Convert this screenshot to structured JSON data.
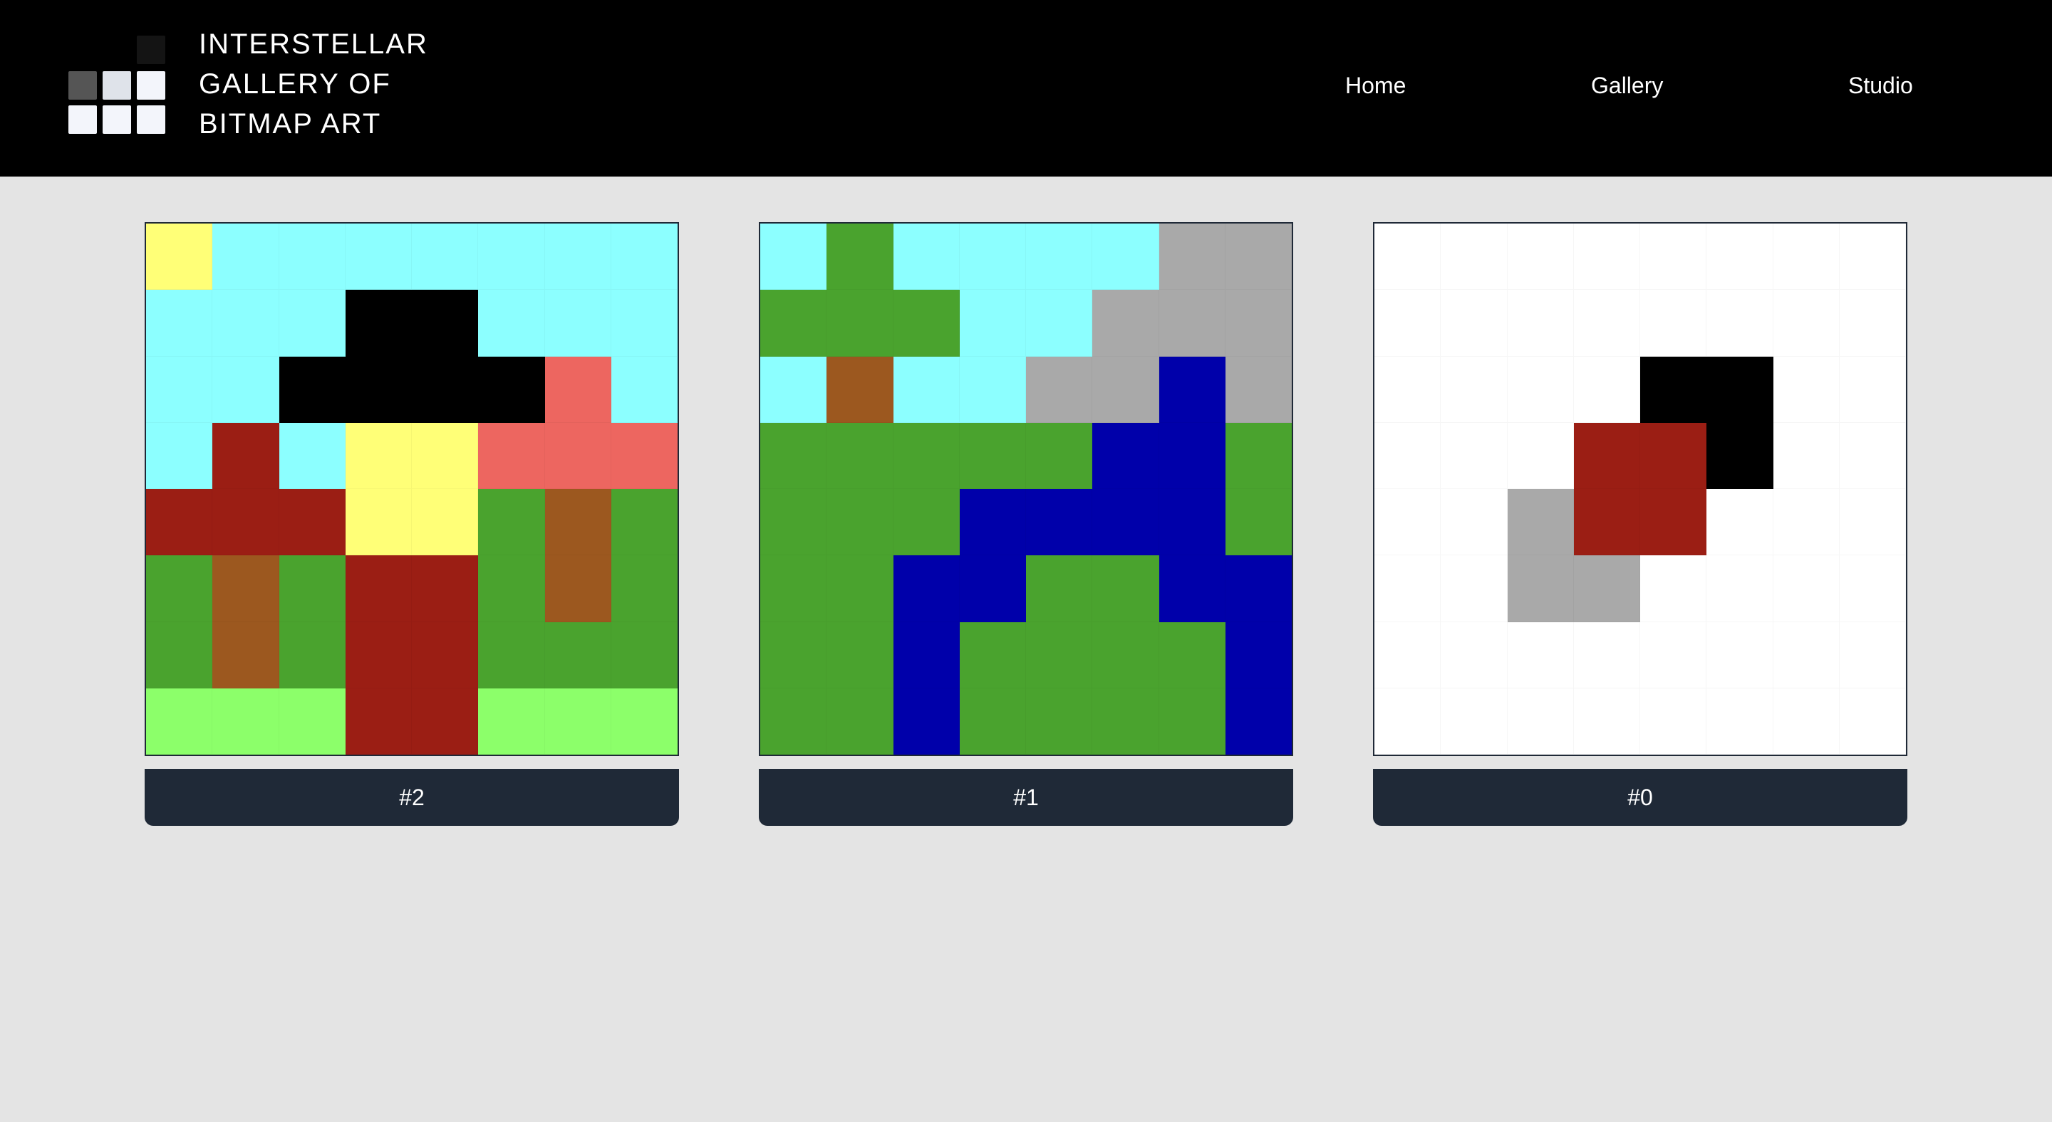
{
  "header": {
    "title": "INTERSTELLAR\nGALLERY OF\nBITMAP ART",
    "logo_icon": "pixel-grid-logo"
  },
  "nav": {
    "items": [
      {
        "label": "Home"
      },
      {
        "label": "Gallery"
      },
      {
        "label": "Studio"
      }
    ]
  },
  "palette": {
    "Y": "#ffff77",
    "S": "#8cffff",
    "K": "#000000",
    "P": "#ed6660",
    "R": "#9b1e14",
    "G": "#4aa32e",
    "B": "#9c581f",
    "L": "#8cff6a",
    "A": "#a9a9a9",
    "N": "#0000aa",
    "W": "#ffffff"
  },
  "artworks": [
    {
      "caption": "#2",
      "pixels": [
        "YSSSSSSS",
        "SSSKKSSS",
        "SSKKKKPS",
        "SRSYYPPP",
        "RRRYYGBG",
        "GBGRRGBG",
        "GBGRRGGG",
        "LLLRRLLL"
      ]
    },
    {
      "caption": "#1",
      "pixels": [
        "SGSSSSAA",
        "GGGSSAAA",
        "SBSSAANA",
        "GGGGGNNG",
        "GGGNNNNG",
        "GGNNGGNN",
        "GGNGGGGN",
        "GGNGGGGN"
      ]
    },
    {
      "caption": "#0",
      "pixels": [
        "WWWWWWWW",
        "WWWWWWWW",
        "WWWWKKWW",
        "WWWRRKWW",
        "WWARRWWW",
        "WWAAWWWW",
        "WWWWWWWW",
        "WWWWWWWW"
      ]
    }
  ]
}
